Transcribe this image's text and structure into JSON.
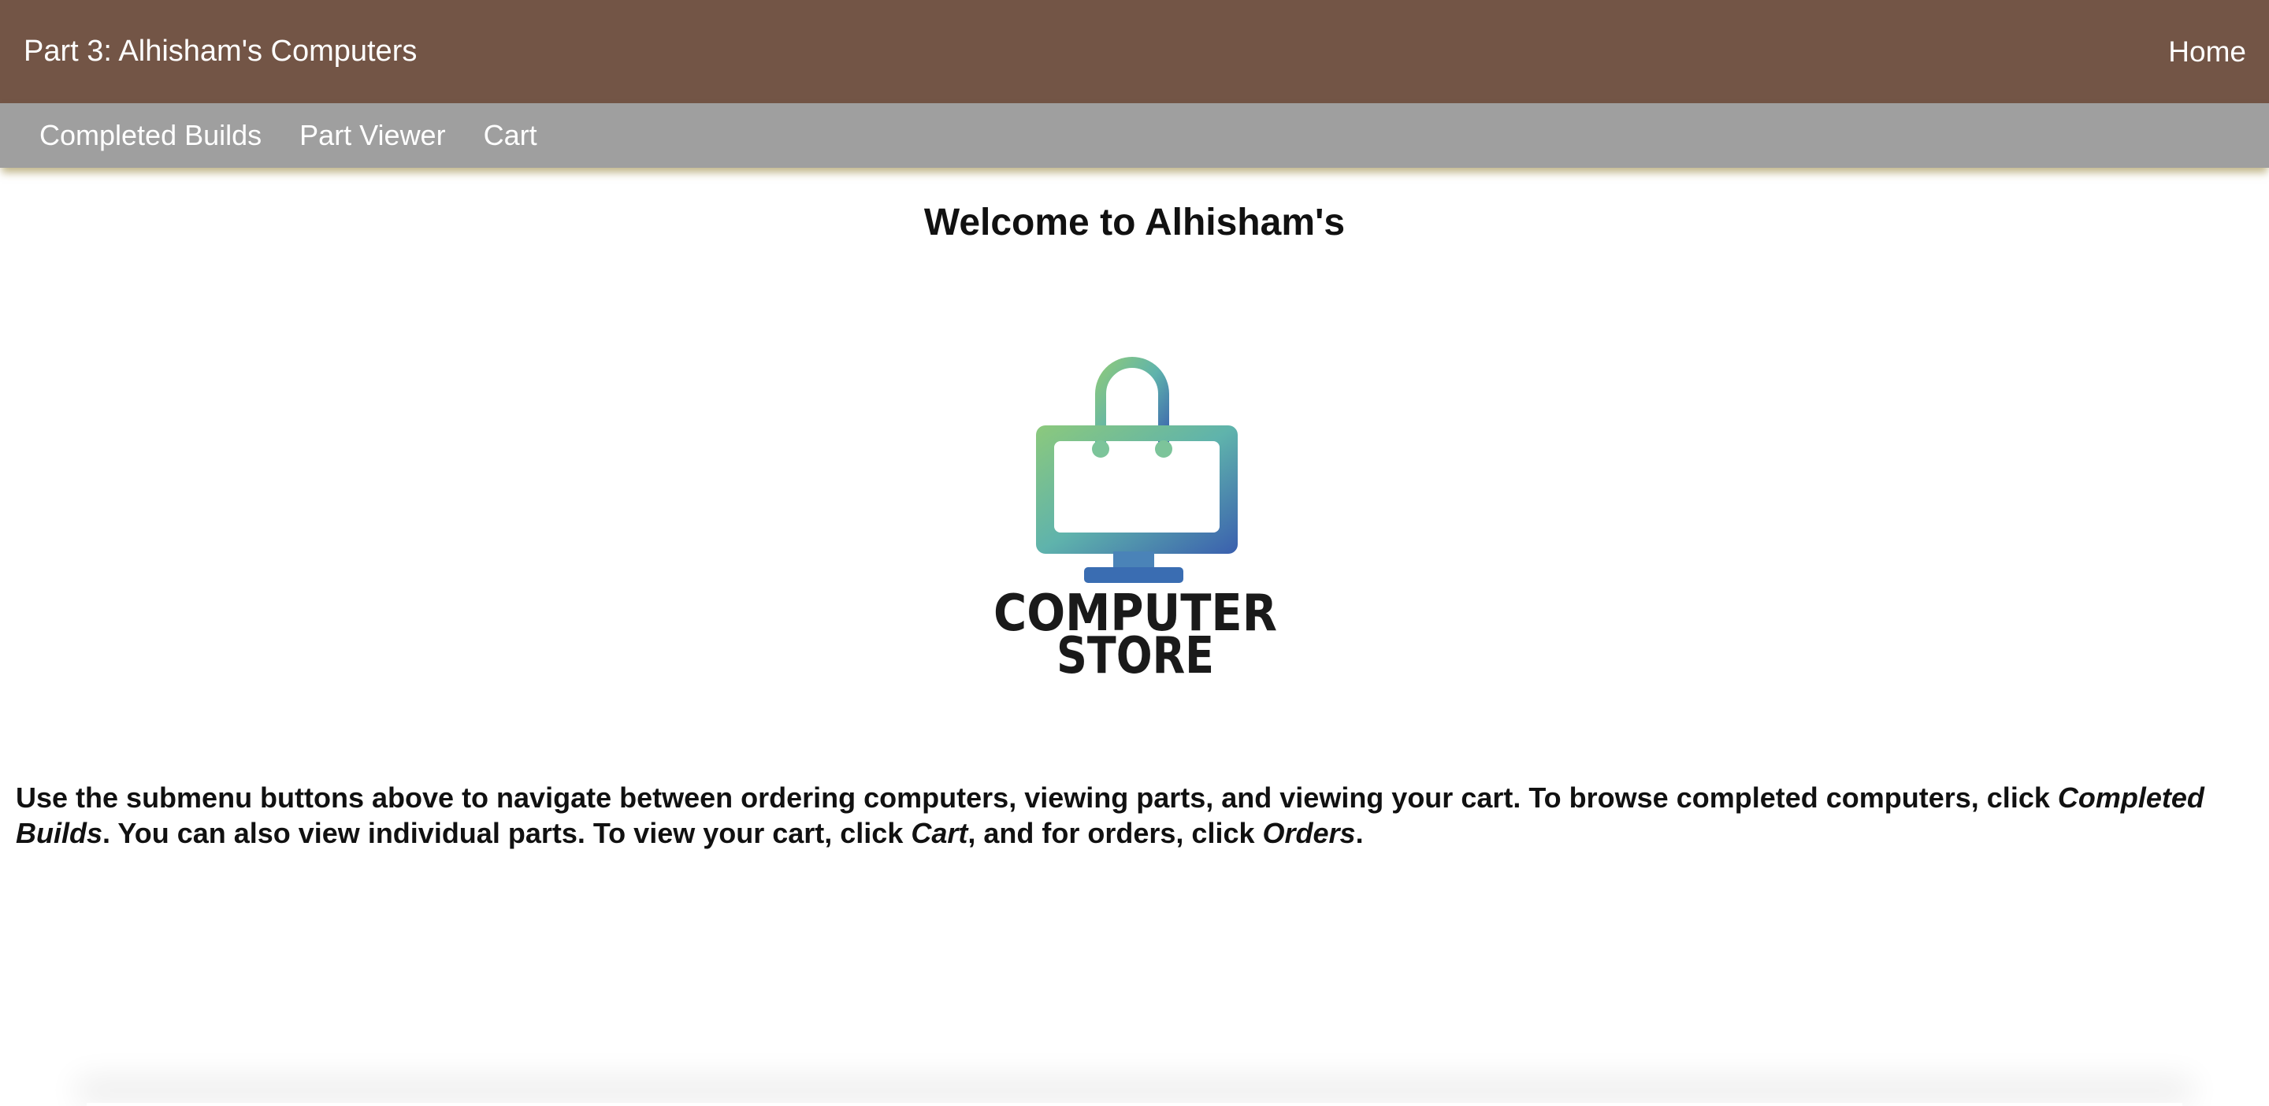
{
  "header": {
    "title": "Part 3: Alhisham's Computers",
    "home_label": "Home"
  },
  "submenu": {
    "items": [
      {
        "label": "Completed Builds"
      },
      {
        "label": "Part Viewer"
      },
      {
        "label": "Cart"
      }
    ]
  },
  "main": {
    "welcome": "Welcome to Alhisham's",
    "logo": {
      "line1": "COMPUTER",
      "line2": "STORE"
    },
    "intro": {
      "part1": "Use the submenu buttons above to navigate between ordering computers, viewing parts, and viewing your cart. To browse completed computers, click ",
      "em1": "Completed Builds",
      "part2": ". You can also view individual parts. To view your cart, click ",
      "em2": "Cart",
      "part3": ", and for orders, click ",
      "em3": "Orders",
      "part4": "."
    }
  },
  "colors": {
    "header_bg": "#735546",
    "submenu_bg": "#9f9f9f",
    "logo_gradient_start": "#8cc97c",
    "logo_gradient_end": "#3a5fae"
  }
}
